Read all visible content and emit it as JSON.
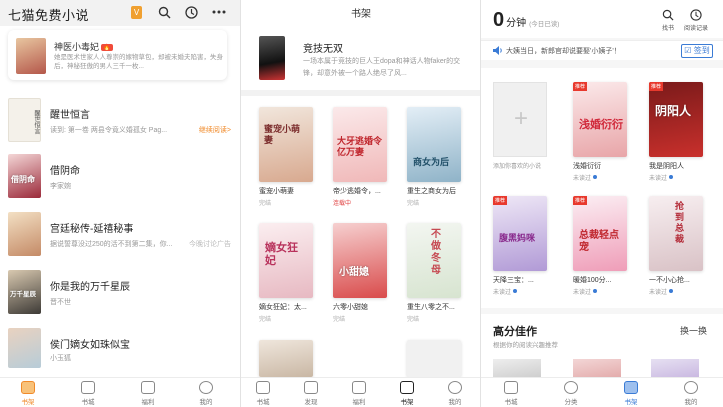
{
  "p1": {
    "title": "七猫免费小说",
    "vip": "V",
    "card": {
      "title": "神医小毒妃",
      "hot": "",
      "desc": "她是医术世家人人尊崇的嫁物草包，却被未婚夫陷害，失身后，神秘狂傲的男人三千一枚..."
    },
    "rows": [
      {
        "title": "醒世恒言",
        "sub": "读到: 第一卷 两县令竟义婚孤女 Pag...",
        "right": "继续阅读>"
      },
      {
        "title": "借阴命",
        "sub": "李家婉"
      },
      {
        "title": "宫廷秘传-延禧秘事",
        "sub": "据说誓尊没过250的活不到第二集，你...",
        "right": "今晚讨论广告"
      },
      {
        "title": "你是我的万千星辰",
        "sub": "晋不世"
      },
      {
        "title": "侯门嫡女如珠似宝",
        "sub": "小玉狐"
      }
    ],
    "cover_texts": [
      "醒世恒言",
      "借阴命",
      "",
      "万千星辰",
      ""
    ],
    "tabs": [
      "书架",
      "书城",
      "福利",
      "我的"
    ]
  },
  "p2": {
    "header": "书架",
    "feature": {
      "title": "竞技无双",
      "desc": "一场本属于竞技的巨人王dopa和神话人物faker的交锋，却意外被一个路人绝尽了风..."
    },
    "books": [
      {
        "name": "蜜宠小萌妻",
        "status": "完结",
        "cover": "蜜宠小萌妻"
      },
      {
        "name": "帝少逃婚令，...",
        "status": "连载中",
        "cover": "大牙逃婚令亿万妻"
      },
      {
        "name": "重生之商女为后",
        "status": "完结",
        "cover": "商女为后"
      },
      {
        "name": "嫡女狂妃：太...",
        "status": "完结",
        "cover": "嫡女狂妃"
      },
      {
        "name": "六零小甜媳",
        "status": "完结",
        "cover": "小甜媳"
      },
      {
        "name": "重生八零之不...",
        "status": "完结",
        "cover": "不做冬母"
      }
    ],
    "tabs": [
      "书城",
      "发现",
      "福利",
      "书架",
      "我的"
    ]
  },
  "p3": {
    "minutes": "0",
    "minutes_unit": "分钟",
    "minutes_note": "(今日已读)",
    "icons": [
      "找书",
      "阅读记录"
    ],
    "notice": "大姨当日，新郎官却说要娶'小姨子'！",
    "sign": "签到",
    "add_label": "添加你喜欢的小说",
    "books": [
      {
        "name": "浅婚衍衍",
        "status": "未读过",
        "cover": "浅婚衍衍"
      },
      {
        "name": "我是阴阳人",
        "status": "未读过",
        "cover": "阴阳人"
      },
      {
        "name": "天降三宝：...",
        "status": "未读过",
        "cover": "腹黑妈咪"
      },
      {
        "name": "暖婚100分...",
        "status": "未读过",
        "cover": "总裁轻点宠"
      },
      {
        "name": "一不小心抢...",
        "status": "未读过",
        "cover": "抢到总裁"
      }
    ],
    "tag": "推荐",
    "section": {
      "title": "高分佳作",
      "sub": "根据你的阅读兴趣推荐",
      "change": "换一换"
    },
    "tabs": [
      "书城",
      "分类",
      "书架",
      "我的"
    ]
  },
  "colors": {
    "orange": "#f08a2a",
    "blue": "#3a7bd5",
    "red": "#e8392d"
  }
}
